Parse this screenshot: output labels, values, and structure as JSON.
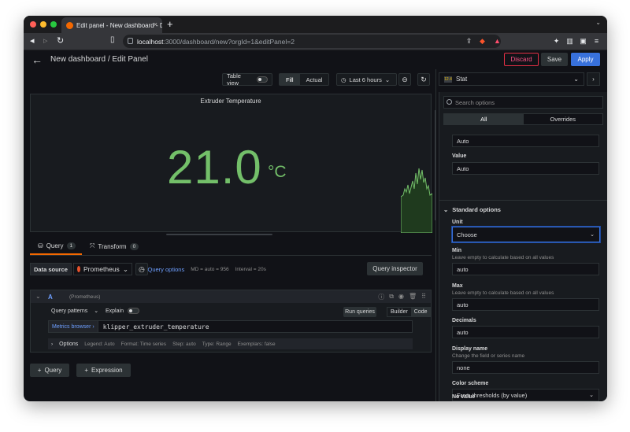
{
  "browser": {
    "tab_title": "Edit panel - New dashboard - D",
    "tab_close": "×",
    "new_tab": "+",
    "tab_menu": "⌄",
    "url_host": "localhost",
    "url_path": ":3000/dashboard/new?orgId=1&editPanel=2"
  },
  "header": {
    "title": "New dashboard / Edit Panel",
    "discard": "Discard",
    "save": "Save",
    "apply": "Apply"
  },
  "toolbar": {
    "table_view": "Table view",
    "fill": "Fill",
    "actual": "Actual",
    "time_range": "Last 6 hours"
  },
  "panel": {
    "title": "Extruder Temperature",
    "value": "21.0",
    "unit": "°C",
    "color": "#73bf69"
  },
  "query_tabs": {
    "query_label": "Query",
    "query_count": "1",
    "transform_label": "Transform",
    "transform_count": "0"
  },
  "datasource": {
    "label": "Data source",
    "name": "Prometheus",
    "query_options": "Query options",
    "md": "MD = auto = 956",
    "interval": "Interval = 20s",
    "inspector": "Query inspector"
  },
  "query": {
    "letter": "A",
    "ds": "(Prometheus)",
    "patterns": "Query patterns",
    "explain": "Explain",
    "run": "Run queries",
    "builder": "Builder",
    "code": "Code",
    "metrics_browser": "Metrics browser ›",
    "expr": "klipper_extruder_temperature",
    "options_label": "Options",
    "legend": "Legend: Auto",
    "format": "Format: Time series",
    "step": "Step: auto",
    "type": "Type: Range",
    "exemplars": "Exemplars: false"
  },
  "add": {
    "query": "Query",
    "expression": "Expression"
  },
  "viz": {
    "icon_text": "12.4",
    "name": "Stat"
  },
  "options": {
    "search_placeholder": "Search options",
    "tab_all": "All",
    "tab_overrides": "Overrides",
    "calc_value": "Auto",
    "value_label": "Value",
    "value_value": "Auto",
    "section": "Standard options",
    "unit_label": "Unit",
    "unit_value": "Choose",
    "min_label": "Min",
    "min_desc": "Leave empty to calculate based on all values",
    "min_value": "auto",
    "max_label": "Max",
    "max_desc": "Leave empty to calculate based on all values",
    "max_value": "auto",
    "decimals_label": "Decimals",
    "decimals_value": "auto",
    "display_label": "Display name",
    "display_desc": "Change the field or series name",
    "display_value": "none",
    "color_label": "Color scheme",
    "color_value": "From thresholds (by value)",
    "novalue_label": "No value"
  }
}
